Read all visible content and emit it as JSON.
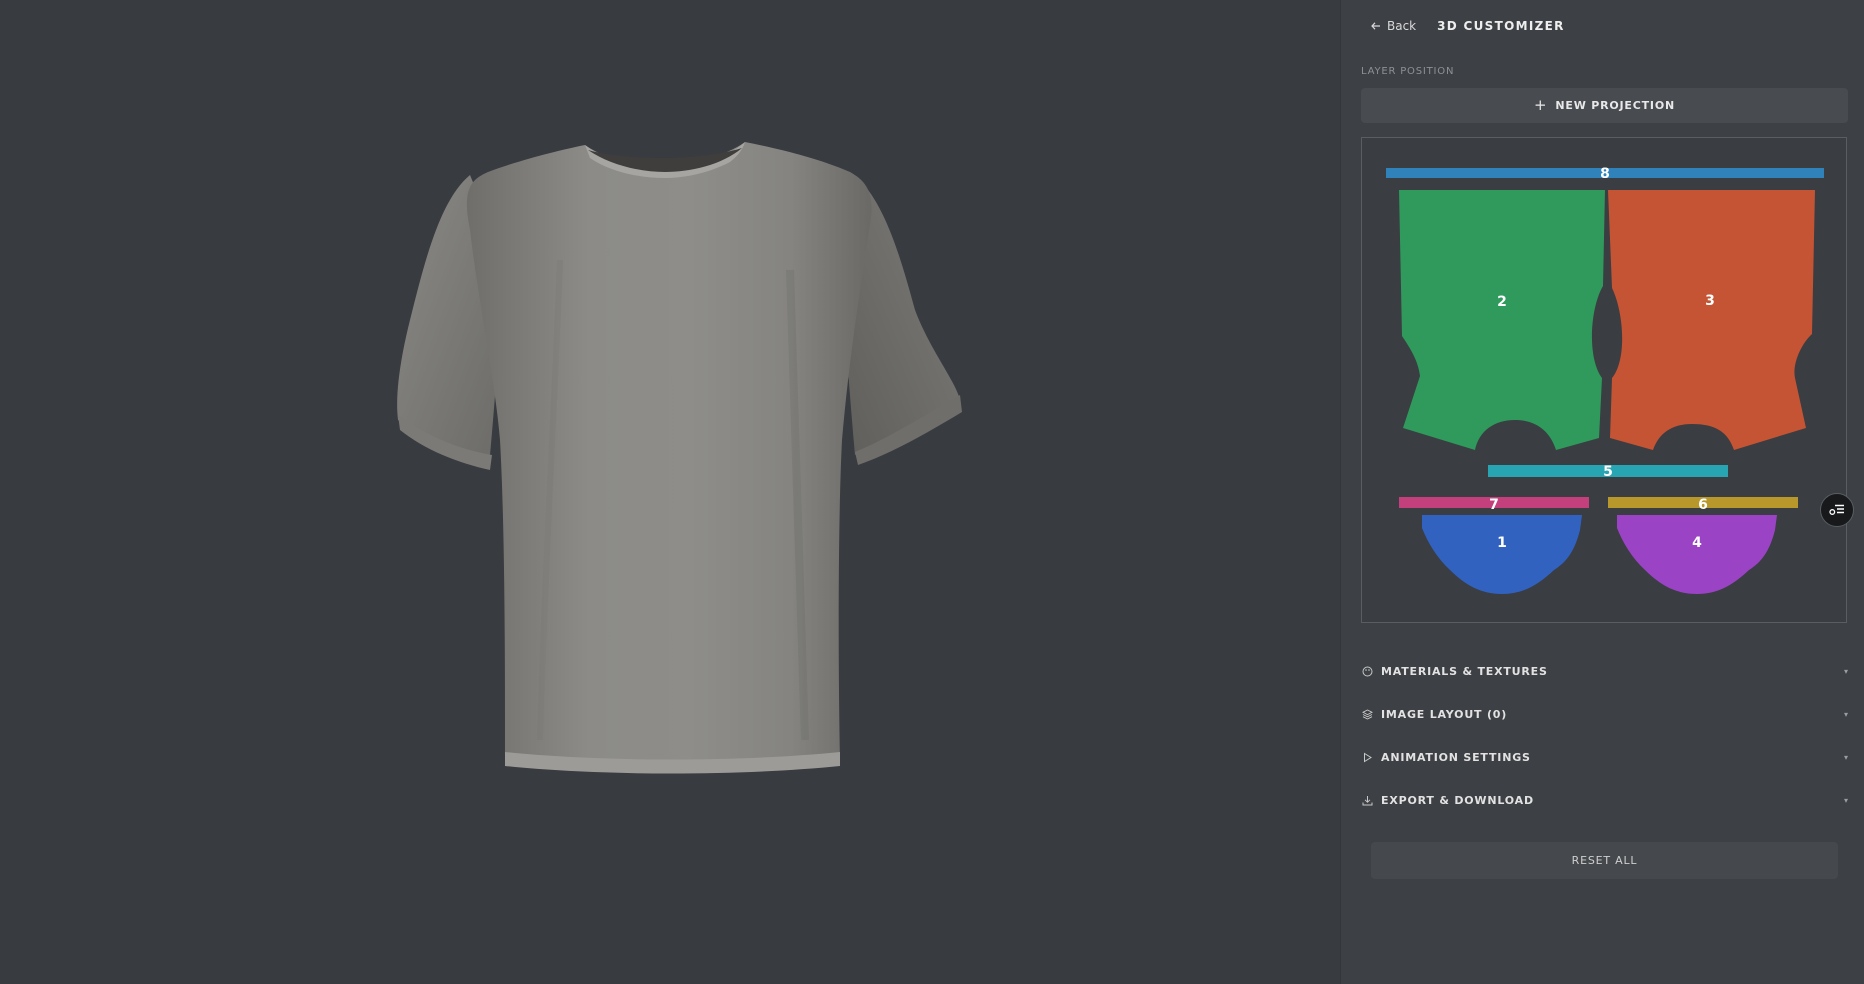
{
  "header": {
    "back_label": "Back",
    "title": "3D CUSTOMIZER"
  },
  "layer_position": {
    "label": "LAYER POSITION",
    "new_projection_label": "NEW PROJECTION",
    "pieces": [
      {
        "number": "8",
        "color": "#2f82ba"
      },
      {
        "number": "2",
        "color": "#2f9a5c"
      },
      {
        "number": "3",
        "color": "#c45434"
      },
      {
        "number": "5",
        "color": "#27a5b2"
      },
      {
        "number": "7",
        "color": "#c4407c"
      },
      {
        "number": "6",
        "color": "#b8972b"
      },
      {
        "number": "1",
        "color": "#3262c0"
      },
      {
        "number": "4",
        "color": "#9b43c5"
      }
    ]
  },
  "accordions": [
    {
      "label": "MATERIALS & TEXTURES",
      "icon": "palette-icon"
    },
    {
      "label": "IMAGE LAYOUT (0)",
      "icon": "layers-icon"
    },
    {
      "label": "ANIMATION SETTINGS",
      "icon": "play-icon"
    },
    {
      "label": "EXPORT & DOWNLOAD",
      "icon": "download-icon"
    }
  ],
  "chevron": "▾",
  "reset_label": "RESET ALL",
  "colors": {
    "viewport_bg": "#383b3f",
    "panel_bg": "#3d4044",
    "shirt": "#8a8985"
  }
}
